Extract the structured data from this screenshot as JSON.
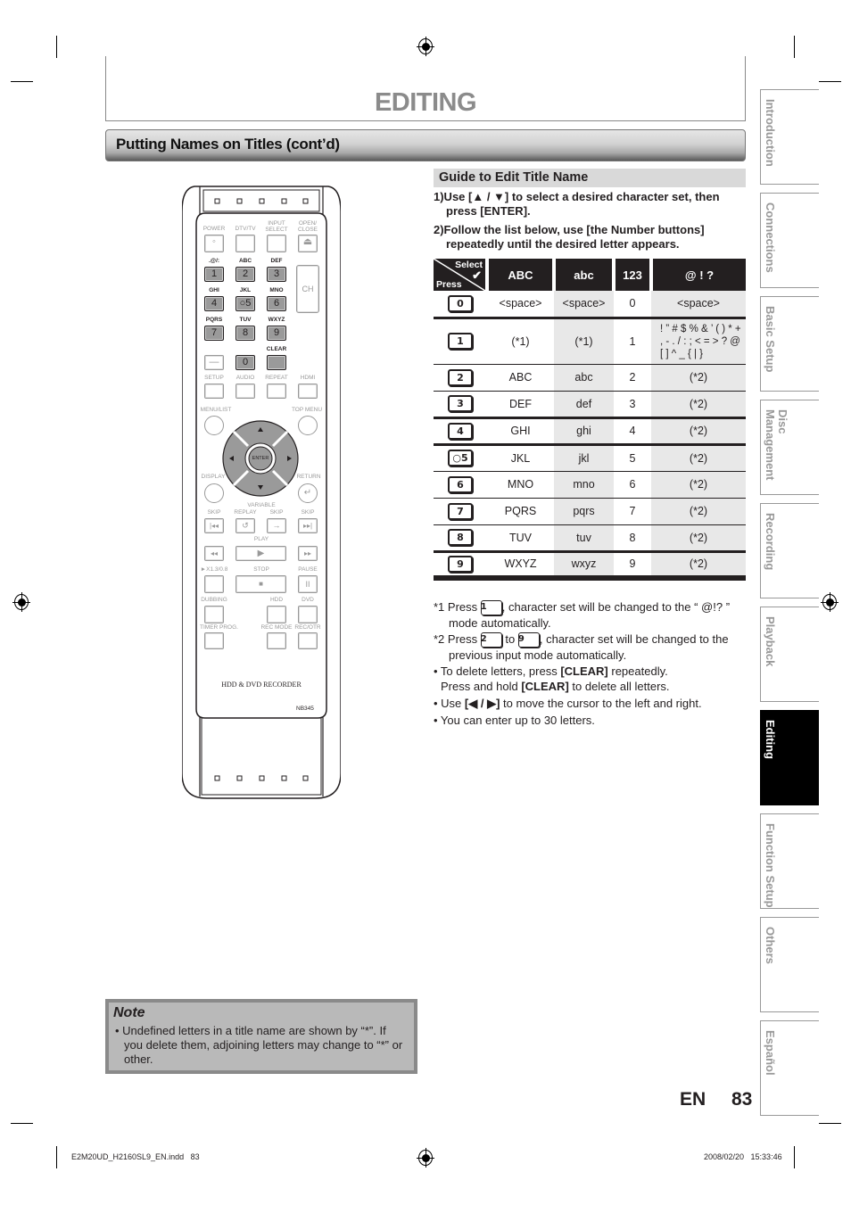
{
  "page": {
    "title": "EDITING",
    "section_title": "Putting Names on Titles (cont’d)",
    "language_code": "EN",
    "page_number": "83"
  },
  "guide": {
    "heading": "Guide to Edit Title Name",
    "steps": [
      "1)Use [▲ / ▼] to select a desired character set, then press [ENTER].",
      "2)Follow the list below, use [the Number buttons] repeatedly until the desired letter appears."
    ]
  },
  "char_table": {
    "corner_select": "Select",
    "corner_press": "Press",
    "columns": [
      "ABC",
      "abc",
      "123",
      "@ ! ?"
    ],
    "rows": [
      {
        "key": "0",
        "abc_upper": "<space>",
        "abc_lower": "<space>",
        "num": "0",
        "sym": "<space>"
      },
      {
        "key": "1",
        "abc_upper": "(*1)",
        "abc_lower": "(*1)",
        "num": "1",
        "sym": "! ” # $ % & ’ ( ) * + , - . / : ; < = > ? @ [ ] ^ _ { | }"
      },
      {
        "key": "2",
        "abc_upper": "ABC",
        "abc_lower": "abc",
        "num": "2",
        "sym": "(*2)"
      },
      {
        "key": "3",
        "abc_upper": "DEF",
        "abc_lower": "def",
        "num": "3",
        "sym": "(*2)"
      },
      {
        "key": "4",
        "abc_upper": "GHI",
        "abc_lower": "ghi",
        "num": "4",
        "sym": "(*2)"
      },
      {
        "key": "○5",
        "abc_upper": "JKL",
        "abc_lower": "jkl",
        "num": "5",
        "sym": "(*2)"
      },
      {
        "key": "6",
        "abc_upper": "MNO",
        "abc_lower": "mno",
        "num": "6",
        "sym": "(*2)"
      },
      {
        "key": "7",
        "abc_upper": "PQRS",
        "abc_lower": "pqrs",
        "num": "7",
        "sym": "(*2)"
      },
      {
        "key": "8",
        "abc_upper": "TUV",
        "abc_lower": "tuv",
        "num": "8",
        "sym": "(*2)"
      },
      {
        "key": "9",
        "abc_upper": "WXYZ",
        "abc_lower": "wxyz",
        "num": "9",
        "sym": "(*2)"
      }
    ]
  },
  "notes": {
    "n1_prefix": "*1 Press",
    "n1_key": "1",
    "n1_suffix": ", character set will be changed to the “ @!? ” mode automatically.",
    "n2_prefix": "*2 Press",
    "n2_key_a": "2",
    "n2_to": "to",
    "n2_key_b": "9",
    "n2_suffix": ", character set will be changed to the previous input mode automatically.",
    "b1_a": "• To delete letters, press ",
    "b1_b": "[CLEAR]",
    "b1_c": " repeatedly.",
    "b1_d": "Press and hold ",
    "b1_e": "[CLEAR]",
    "b1_f": " to delete all letters.",
    "b2_a": "• Use ",
    "b2_b": "[◀ / ▶]",
    "b2_c": " to move the cursor to the left and right.",
    "b3": "• You can enter up to 30 letters."
  },
  "note_box": {
    "title": "Note",
    "text": "• Undefined letters in a title name are shown by “*”. If you delete them, adjoining letters may change to “*” or other."
  },
  "side_tabs": [
    {
      "label": "Introduction",
      "active": false
    },
    {
      "label": "Connections",
      "active": false
    },
    {
      "label": "Basic Setup",
      "active": false
    },
    {
      "label": "Disc Management",
      "active": false
    },
    {
      "label": "Recording",
      "active": false
    },
    {
      "label": "Playback",
      "active": false
    },
    {
      "label": "Editing",
      "active": true
    },
    {
      "label": "Function Setup",
      "active": false
    },
    {
      "label": "Others",
      "active": false
    },
    {
      "label": "Español",
      "active": false
    }
  ],
  "remote": {
    "labels": {
      "power": "POWER",
      "dtv_tv": "DTV/TV",
      "input_select": "INPUT SELECT",
      "open_close": "OPEN/ CLOSE",
      "k1": ".@/:",
      "k2": "ABC",
      "k3": "DEF",
      "k4": "GHI",
      "k5": "JKL",
      "k6": "MNO",
      "k7": "PQRS",
      "k8": "TUV",
      "k9": "WXYZ",
      "ch": "CH",
      "clear": "CLEAR",
      "setup": "SETUP",
      "audio": "AUDIO",
      "repeat": "REPEAT",
      "hdmi": "HDMI",
      "menu_list": "MENU/LIST",
      "top_menu": "TOP MENU",
      "enter": "ENTER",
      "display": "DISPLAY",
      "return": "RETURN",
      "variable": "VARIABLE",
      "skip": "SKIP",
      "replay": "REPLAY",
      "play": "PLAY",
      "speed": "►X1.3/0.8",
      "stop": "STOP",
      "pause": "PAUSE",
      "dubbing": "DUBBING",
      "hdd": "HDD",
      "dvd": "DVD",
      "timer_prog": "TIMER PROG.",
      "rec_mode": "REC MODE",
      "rec_otr": "REC/OTR",
      "brand_text": "HDD & DVD RECORDER",
      "model": "NB345"
    },
    "number_keys": [
      "1",
      "2",
      "3",
      "4",
      "○5",
      "6",
      "7",
      "8",
      "9",
      "0"
    ],
    "dash_key": "—"
  },
  "footer": {
    "file": "E2M20UD_H2160SL9_EN.indd   83",
    "timestamp": "2008/02/20   15:33:46"
  }
}
